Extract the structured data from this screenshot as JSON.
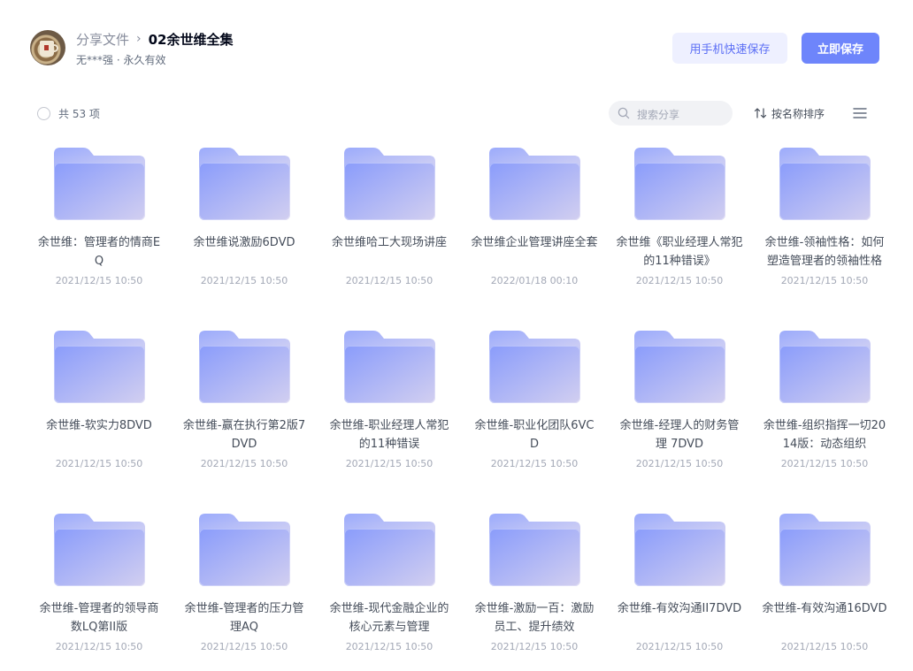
{
  "header": {
    "breadcrumb_root": "分享文件",
    "breadcrumb_separator": "›",
    "title": "02余世维全集",
    "meta": "无***强 · 永久有效",
    "btn_phone_label": "用手机快速保存",
    "btn_save_label": "立即保存"
  },
  "toolbar": {
    "count_label": "共 53 项",
    "search_placeholder": "搜索分享",
    "sort_label": "按名称排序"
  },
  "colors": {
    "accent": "#6e85fb",
    "accent_light": "#eef0ff",
    "folder_start": "#8a9cfb",
    "folder_end": "#d2cff0"
  },
  "files": [
    {
      "name": "余世维：管理者的情商EQ",
      "date": "2021/12/15 10:50",
      "icon": "folder-icon"
    },
    {
      "name": "余世维说激励6DVD",
      "date": "2021/12/15 10:50",
      "icon": "folder-icon"
    },
    {
      "name": "余世维哈工大现场讲座",
      "date": "2021/12/15 10:50",
      "icon": "folder-icon"
    },
    {
      "name": "余世维企业管理讲座全套",
      "date": "2022/01/18 00:10",
      "icon": "folder-icon"
    },
    {
      "name": "余世维《职业经理人常犯的11种错误》",
      "date": "2021/12/15 10:50",
      "icon": "folder-icon"
    },
    {
      "name": "余世维-领袖性格：如何塑造管理者的领袖性格",
      "date": "2021/12/15 10:50",
      "icon": "folder-icon"
    },
    {
      "name": "余世维-软实力8DVD",
      "date": "2021/12/15 10:50",
      "icon": "folder-icon"
    },
    {
      "name": "余世维-赢在执行第2版7DVD",
      "date": "2021/12/15 10:50",
      "icon": "folder-icon"
    },
    {
      "name": "余世维-职业经理人常犯的11种错误",
      "date": "2021/12/15 10:50",
      "icon": "folder-icon"
    },
    {
      "name": "余世维-职业化团队6VCD",
      "date": "2021/12/15 10:50",
      "icon": "folder-icon"
    },
    {
      "name": "余世维-经理人的财务管理 7DVD",
      "date": "2021/12/15 10:50",
      "icon": "folder-icon"
    },
    {
      "name": "余世维-组织指挥一切2014版：动态组织",
      "date": "2021/12/15 10:50",
      "icon": "folder-icon"
    },
    {
      "name": "余世维-管理者的领导商数LQ第II版",
      "date": "2021/12/15 10:50",
      "icon": "folder-icon"
    },
    {
      "name": "余世维-管理者的压力管理AQ",
      "date": "2021/12/15 10:50",
      "icon": "folder-icon"
    },
    {
      "name": "余世维-现代金融企业的核心元素与管理",
      "date": "2021/12/15 10:50",
      "icon": "folder-icon"
    },
    {
      "name": "余世维-激励一百：激励员工、提升绩效",
      "date": "2021/12/15 10:50",
      "icon": "folder-icon"
    },
    {
      "name": "余世维-有效沟通II7DVD",
      "date": "2021/12/15 10:50",
      "icon": "folder-icon"
    },
    {
      "name": "余世维-有效沟通16DVD",
      "date": "2021/12/15 10:50",
      "icon": "folder-icon"
    }
  ]
}
